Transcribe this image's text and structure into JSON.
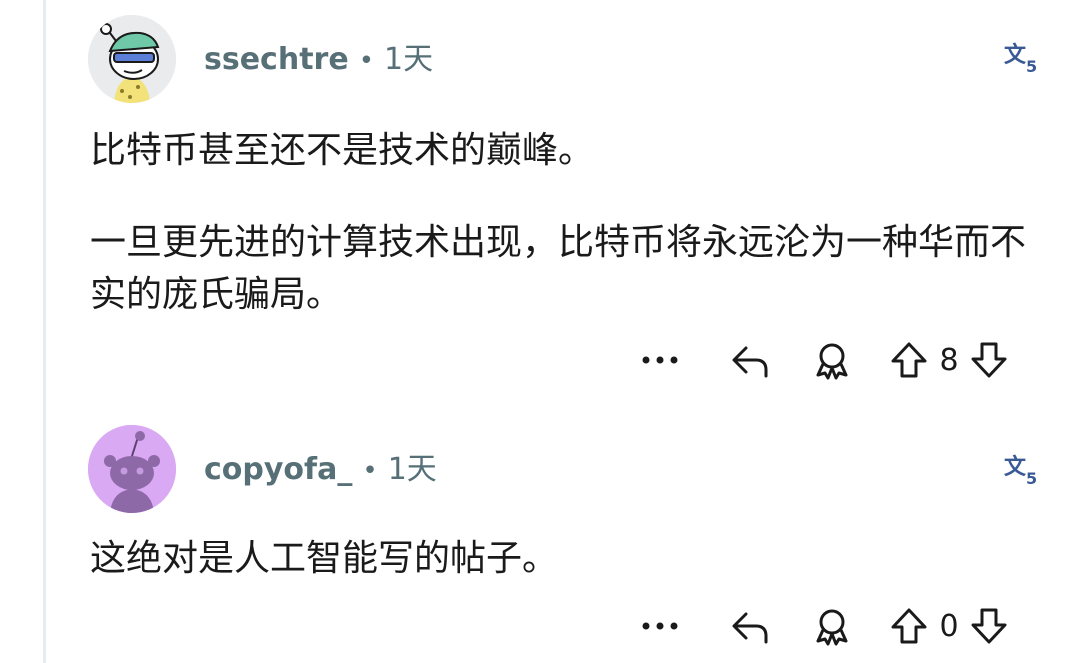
{
  "comments": [
    {
      "username": "ssechtre",
      "separator": "•",
      "time": "1天",
      "paragraphs": [
        "比特币甚至还不是技术的巅峰。",
        "一旦更先进的计算技术出现，比特币将永远沦为一种华而不实的庞氏骗局。"
      ],
      "score": "8",
      "avatar_icon": "snoo-sunglasses-avatar-icon"
    },
    {
      "username": "copyofa_",
      "separator": "•",
      "time": "1天",
      "paragraphs": [
        "这绝对是人工智能写的帖子。"
      ],
      "score": "0",
      "avatar_icon": "snoo-default-avatar-icon"
    }
  ],
  "colors": {
    "meta_text": "#576f76",
    "body_text": "#1a1a1b",
    "thread_line": "#e9ecee",
    "avatar2_bg": "#d9a9f3",
    "translate_icon": "#3a5a96"
  }
}
